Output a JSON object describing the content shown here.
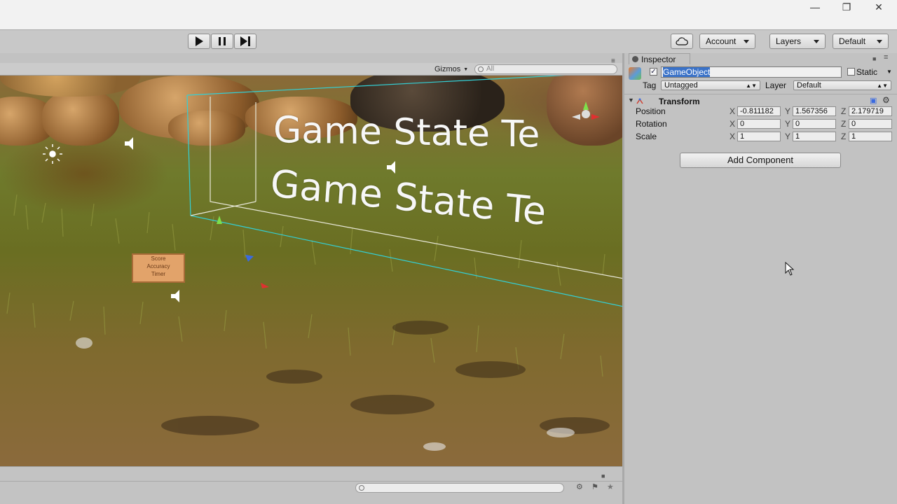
{
  "window": {
    "minimize_icon": "minimize-icon",
    "restore_icon": "restore-icon",
    "close_icon": "close-icon"
  },
  "toolbar": {
    "play_icon": "play-icon",
    "pause_icon": "pause-icon",
    "step_icon": "step-icon",
    "cloud_icon": "cloud-icon",
    "account_label": "Account",
    "layers_label": "Layers",
    "layout_label": "Default"
  },
  "scene": {
    "gizmos_label": "Gizmos",
    "search_placeholder": "All",
    "world_text_1": "Game State Te",
    "world_text_2": "Game State Te",
    "sign_lines": [
      "Score",
      "Accuracy",
      "Timer"
    ]
  },
  "inspector": {
    "tab_label": "Inspector",
    "active": true,
    "object_name": "GameObject",
    "static_label": "Static",
    "tag_label": "Tag",
    "tag_value": "Untagged",
    "layer_label": "Layer",
    "layer_value": "Default",
    "component_title": "Transform",
    "rows": [
      {
        "label": "Position",
        "x": "-0.811182",
        "y": "1.567356",
        "z": "2.179719"
      },
      {
        "label": "Rotation",
        "x": "0",
        "y": "0",
        "z": "0"
      },
      {
        "label": "Scale",
        "x": "1",
        "y": "1",
        "z": "1"
      }
    ],
    "axis_x": "X",
    "axis_y": "Y",
    "axis_z": "Z",
    "add_component_label": "Add Component"
  }
}
